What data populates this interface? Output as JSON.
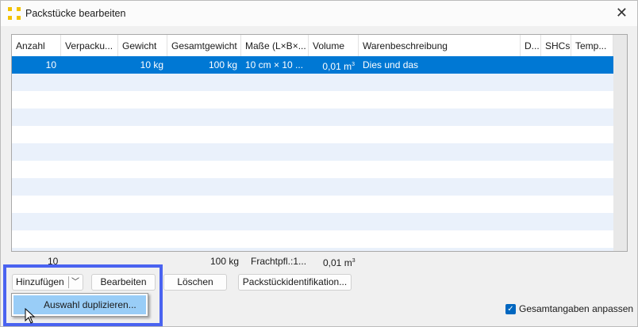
{
  "window": {
    "title": "Packstücke bearbeiten",
    "close_icon": "close-icon"
  },
  "table": {
    "columns": [
      "Anzahl",
      "Verpacku...",
      "Gewicht",
      "Gesamtgewicht",
      "Maße (L×B×...",
      "Volume",
      "Warenbeschreibung",
      "D...",
      "SHCs",
      "Temp..."
    ],
    "rows": [
      {
        "anzahl": "10",
        "verpackung": "",
        "gewicht": "10 kg",
        "gesamtgewicht": "100 kg",
        "masse": "10 cm × 10 ...",
        "volume": "0,01 m",
        "volume_sup": "3",
        "beschreibung": "Dies und das",
        "d": "",
        "shcs": "",
        "temp": ""
      }
    ]
  },
  "totals": {
    "anzahl": "10",
    "gesamtgewicht": "100 kg",
    "frachtpfl": "Frachtpfl.:1...",
    "volume": "0,01 m",
    "volume_sup": "3"
  },
  "buttons": {
    "add": "Hinzufügen",
    "edit": "Bearbeiten",
    "delete": "Löschen",
    "ident": "Packstückidentifikation..."
  },
  "dropdown_menu": {
    "items": [
      "Auswahl duplizieren..."
    ]
  },
  "checkbox": {
    "label": "Gesamtangaben anpassen",
    "checked": true
  },
  "colors": {
    "selection": "#0078d4",
    "menu_highlight": "#99cdf7",
    "annotation_box": "#4a63f0"
  }
}
